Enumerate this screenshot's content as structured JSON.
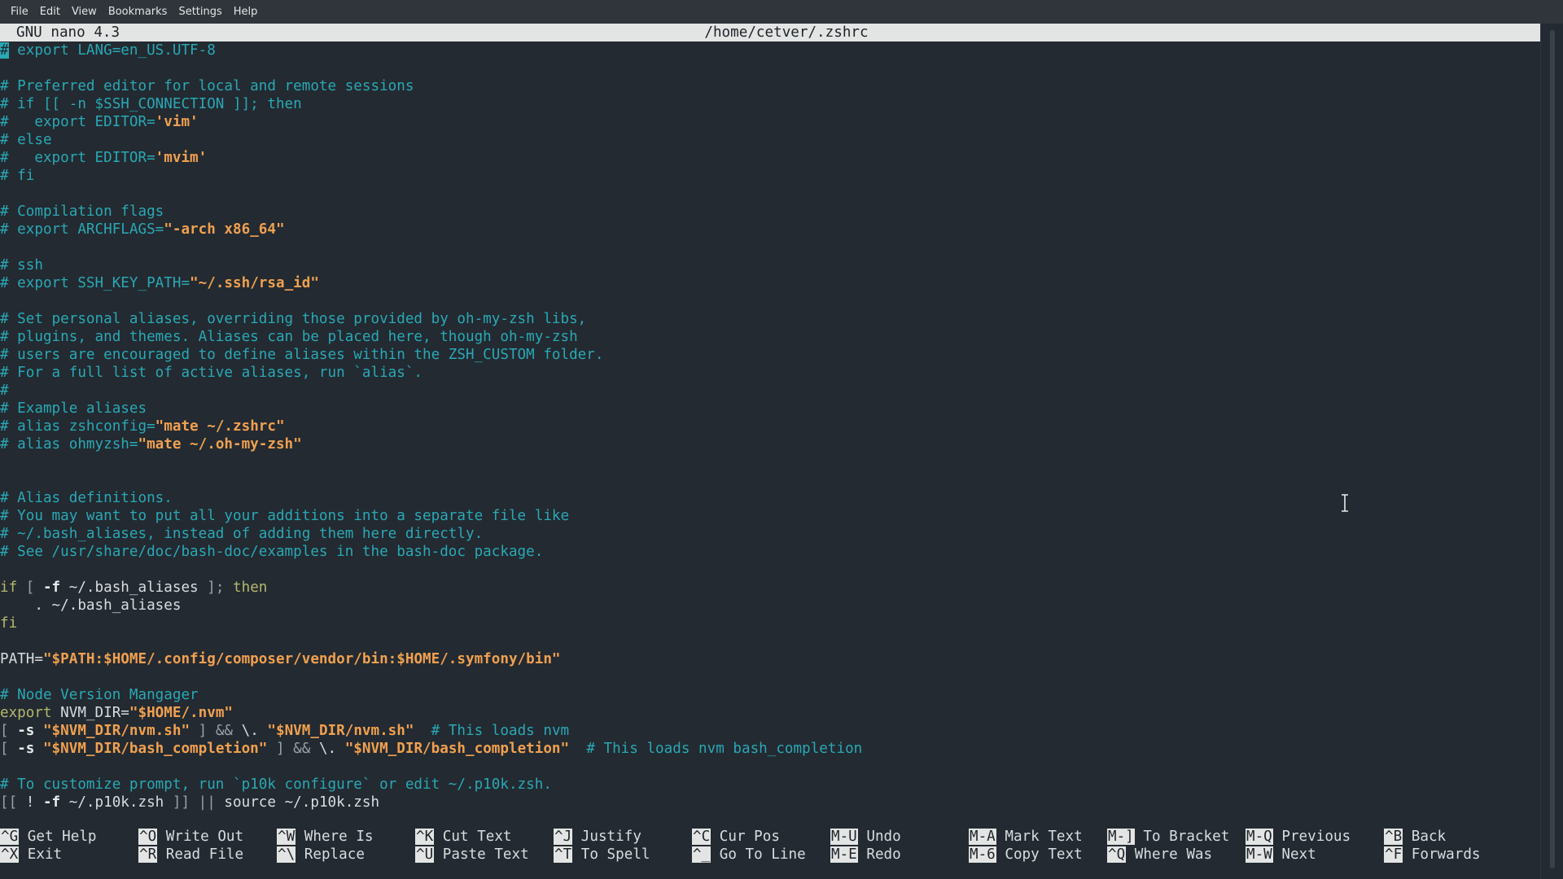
{
  "menu": [
    "File",
    "Edit",
    "View",
    "Bookmarks",
    "Settings",
    "Help"
  ],
  "nano": {
    "version": "GNU nano 4.3",
    "filepath": "/home/cetver/.zshrc"
  },
  "lines": [
    [
      [
        "cursor",
        "#"
      ],
      [
        "cm",
        " export LANG=en_US.UTF-8"
      ]
    ],
    [],
    [
      [
        "cm",
        "# Preferred editor for local and remote sessions"
      ]
    ],
    [
      [
        "cm",
        "# if [[ -n $SSH_CONNECTION ]]; then"
      ]
    ],
    [
      [
        "cm",
        "#   export EDITOR="
      ],
      [
        "str",
        "'vim'"
      ]
    ],
    [
      [
        "cm",
        "# else"
      ]
    ],
    [
      [
        "cm",
        "#   export EDITOR="
      ],
      [
        "str",
        "'mvim'"
      ]
    ],
    [
      [
        "cm",
        "# fi"
      ]
    ],
    [],
    [
      [
        "cm",
        "# Compilation flags"
      ]
    ],
    [
      [
        "cm",
        "# export ARCHFLAGS="
      ],
      [
        "str",
        "\"-arch x86_64\""
      ]
    ],
    [],
    [
      [
        "cm",
        "# ssh"
      ]
    ],
    [
      [
        "cm",
        "# export SSH_KEY_PATH="
      ],
      [
        "str",
        "\"~/.ssh/rsa_id\""
      ]
    ],
    [],
    [
      [
        "cm",
        "# Set personal aliases, overriding those provided by oh-my-zsh libs,"
      ]
    ],
    [
      [
        "cm",
        "# plugins, and themes. Aliases can be placed here, though oh-my-zsh"
      ]
    ],
    [
      [
        "cm",
        "# users are encouraged to define aliases within the ZSH_CUSTOM folder."
      ]
    ],
    [
      [
        "cm",
        "# For a full list of active aliases, run `alias`."
      ]
    ],
    [
      [
        "cm",
        "#"
      ]
    ],
    [
      [
        "cm",
        "# Example aliases"
      ]
    ],
    [
      [
        "cm",
        "# alias zshconfig="
      ],
      [
        "str",
        "\"mate ~/.zshrc\""
      ]
    ],
    [
      [
        "cm",
        "# alias ohmyzsh="
      ],
      [
        "str",
        "\"mate ~/.oh-my-zsh\""
      ]
    ],
    [],
    [],
    [
      [
        "cm",
        "# Alias definitions."
      ]
    ],
    [
      [
        "cm",
        "# You may want to put all your additions into a separate file like"
      ]
    ],
    [
      [
        "cm",
        "# ~/.bash_aliases, instead of adding them here directly."
      ]
    ],
    [
      [
        "cm",
        "# See /usr/share/doc/bash-doc/examples in the bash-doc package."
      ]
    ],
    [],
    [
      [
        "kw",
        "if"
      ],
      [
        "op",
        " [ "
      ],
      [
        "flag",
        "-f"
      ],
      [
        "wh",
        " ~/.bash_aliases "
      ],
      [
        "op",
        "];"
      ],
      [
        "kw",
        " then"
      ]
    ],
    [
      [
        "wh",
        "    . ~/.bash_aliases"
      ]
    ],
    [
      [
        "kw",
        "fi"
      ]
    ],
    [],
    [
      [
        "wh",
        "PATH="
      ],
      [
        "str",
        "\"$PATH:$HOME/.config/composer/vendor/bin:$HOME/.symfony/bin\""
      ]
    ],
    [],
    [
      [
        "cm",
        "# Node Version Mangager"
      ]
    ],
    [
      [
        "kw",
        "export"
      ],
      [
        "wh",
        " NVM_DIR="
      ],
      [
        "str",
        "\"$HOME/.nvm\""
      ]
    ],
    [
      [
        "op",
        "[ "
      ],
      [
        "flag",
        "-s"
      ],
      [
        "wh",
        " "
      ],
      [
        "str",
        "\"$NVM_DIR/nvm.sh\""
      ],
      [
        "op",
        " ] && "
      ],
      [
        "wh",
        "\\. "
      ],
      [
        "str",
        "\"$NVM_DIR/nvm.sh\""
      ],
      [
        "wh",
        "  "
      ],
      [
        "cm",
        "# This loads nvm"
      ]
    ],
    [
      [
        "op",
        "[ "
      ],
      [
        "flag",
        "-s"
      ],
      [
        "wh",
        " "
      ],
      [
        "str",
        "\"$NVM_DIR/bash_completion\""
      ],
      [
        "op",
        " ] && "
      ],
      [
        "wh",
        "\\. "
      ],
      [
        "str",
        "\"$NVM_DIR/bash_completion\""
      ],
      [
        "wh",
        "  "
      ],
      [
        "cm",
        "# This loads nvm bash_completion"
      ]
    ],
    [],
    [
      [
        "cm",
        "# To customize prompt, run `p10k configure` or edit ~/.p10k.zsh."
      ]
    ],
    [
      [
        "op",
        "[[ "
      ],
      [
        "wh",
        "! "
      ],
      [
        "flag",
        "-f"
      ],
      [
        "wh",
        " ~/.p10k.zsh "
      ],
      [
        "op",
        "]] || "
      ],
      [
        "wh",
        "source ~/.p10k.zsh"
      ]
    ]
  ],
  "shortcuts": [
    [
      {
        "key": "^G",
        "label": "Get Help"
      },
      {
        "key": "^X",
        "label": "Exit"
      }
    ],
    [
      {
        "key": "^O",
        "label": "Write Out"
      },
      {
        "key": "^R",
        "label": "Read File"
      }
    ],
    [
      {
        "key": "^W",
        "label": "Where Is"
      },
      {
        "key": "^\\",
        "label": "Replace"
      }
    ],
    [
      {
        "key": "^K",
        "label": "Cut Text"
      },
      {
        "key": "^U",
        "label": "Paste Text"
      }
    ],
    [
      {
        "key": "^J",
        "label": "Justify"
      },
      {
        "key": "^T",
        "label": "To Spell"
      }
    ],
    [
      {
        "key": "^C",
        "label": "Cur Pos"
      },
      {
        "key": "^_",
        "label": "Go To Line"
      }
    ],
    [
      {
        "key": "M-U",
        "label": "Undo"
      },
      {
        "key": "M-E",
        "label": "Redo"
      }
    ],
    [
      {
        "key": "M-A",
        "label": "Mark Text"
      },
      {
        "key": "M-6",
        "label": "Copy Text"
      }
    ],
    [
      {
        "key": "M-]",
        "label": "To Bracket"
      },
      {
        "key": "^Q",
        "label": "Where Was"
      }
    ],
    [
      {
        "key": "M-Q",
        "label": "Previous"
      },
      {
        "key": "M-W",
        "label": "Next"
      }
    ],
    [
      {
        "key": "^B",
        "label": "Back"
      },
      {
        "key": "^F",
        "label": "Forwards"
      }
    ]
  ]
}
